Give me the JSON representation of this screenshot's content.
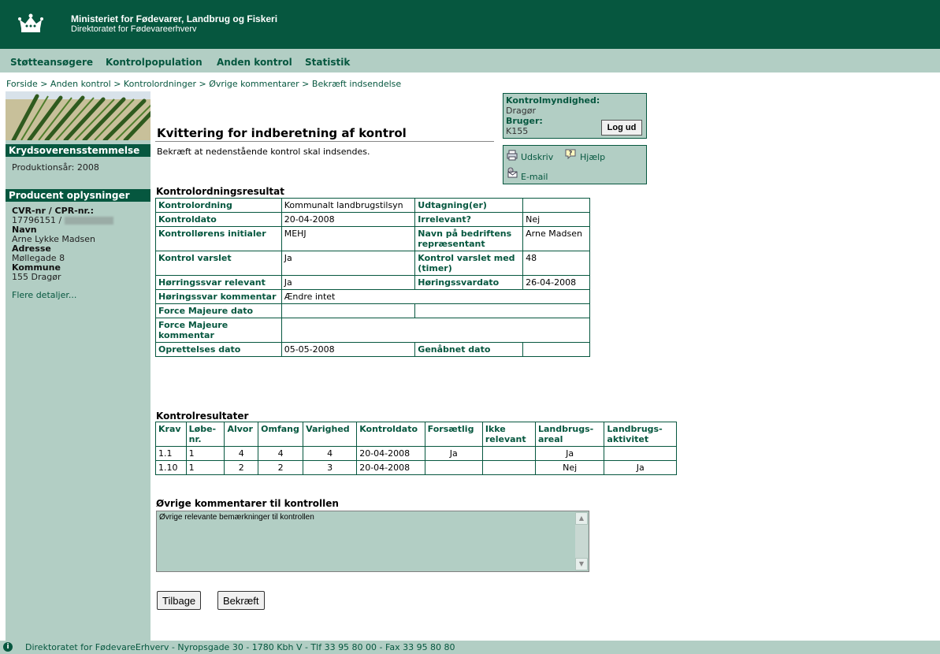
{
  "header": {
    "title": "Ministeriet for Fødevarer, Landbrug og Fiskeri",
    "subtitle": "Direktoratet for Fødevareerhverv"
  },
  "nav": [
    "Støtteansøgere",
    "Kontrolpopulation",
    "Anden kontrol",
    "Statistik"
  ],
  "breadcrumb": "Forside > Anden kontrol > Kontrolordninger > Øvrige kommentarer > Bekræft indsendelse",
  "sidebar": {
    "section1_title": "Krydsoverensstemmelse",
    "production_year": "Produktionsår: 2008",
    "section2_title": "Producent oplysninger",
    "cvr_label": "CVR-nr / CPR-nr.:",
    "cvr_value": "17796151 / ",
    "name_label": "Navn",
    "name_value": "Arne Lykke Madsen",
    "address_label": "Adresse",
    "address_value": "Møllegade 8",
    "municipality_label": "Kommune",
    "municipality_value": "155 Dragør",
    "more_link": "Flere detaljer..."
  },
  "page": {
    "title": "Kvittering for indberetning af kontrol",
    "subtitle": "Bekræft at nedenstående kontrol skal indsendes."
  },
  "authority_box": {
    "authority_label": "Kontrolmyndighed:",
    "authority_value": "Dragør",
    "user_label": "Bruger:",
    "user_value": "K155",
    "logout_label": "Log ud"
  },
  "tools": {
    "print": "Udskriv",
    "help": "Hjælp",
    "email": "E-mail"
  },
  "kontrolordning": {
    "section_title": "Kontrolordningsresultat",
    "r1": [
      "Kontrolordning",
      "Kommunalt landbrugstilsyn",
      "Udtagning(er)",
      ""
    ],
    "r2": [
      "Kontroldato",
      "20-04-2008",
      "Irrelevant?",
      "Nej"
    ],
    "r3": [
      "Kontrollørens initialer",
      "MEHJ",
      "Navn på bedriftens repræsentant",
      "Arne Madsen"
    ],
    "r4": [
      "Kontrol varslet",
      "Ja",
      "Kontrol varslet med (timer)",
      "48"
    ],
    "r5": [
      "Hørringssvar relevant",
      "Ja",
      "Høringssvardato",
      "26-04-2008"
    ],
    "r6": [
      "Høringssvar kommentar",
      "Ændre intet"
    ],
    "r7": [
      "Force Majeure dato",
      "",
      ""
    ],
    "r8": [
      "Force Majeure kommentar",
      ""
    ],
    "r9": [
      "Oprettelses dato",
      "05-05-2008",
      "Genåbnet dato",
      ""
    ]
  },
  "kontrolresultater": {
    "section_title": "Kontrolresultater",
    "headers": [
      "Krav",
      "Løbe-nr.",
      "Alvor",
      "Omfang",
      "Varighed",
      "Kontroldato",
      "Forsætlig",
      "Ikke relevant",
      "Landbrugs-areal",
      "Landbrugs-aktivitet"
    ],
    "rows": [
      [
        "1.1",
        "1",
        "4",
        "4",
        "4",
        "20-04-2008",
        "Ja",
        "",
        "Ja",
        ""
      ],
      [
        "1.10",
        "1",
        "2",
        "2",
        "3",
        "20-04-2008",
        "",
        "",
        "Nej",
        "Ja"
      ]
    ]
  },
  "comments": {
    "section_title": "Øvrige kommentarer til kontrollen",
    "value": "Øvrige relevante bemærkninger til kontrollen"
  },
  "buttons": {
    "back": "Tilbage",
    "confirm": "Bekræft"
  },
  "footer": "Direktoratet for FødevareErhverv - Nyropsgade 30 - 1780 Kbh V - Tlf 33 95 80 00 - Fax 33 95 80 80",
  "colors": {
    "primary_green": "#06573f",
    "light_green": "#b2cec4"
  }
}
